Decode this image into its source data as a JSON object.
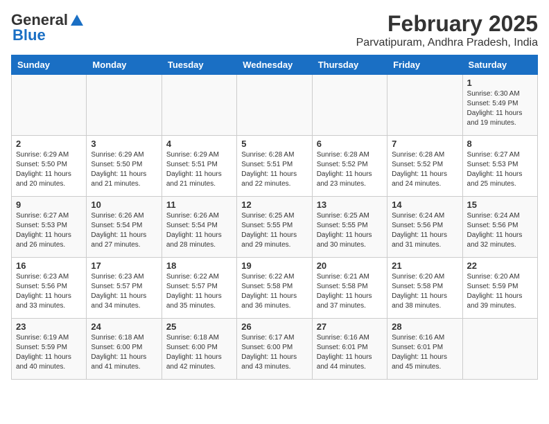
{
  "header": {
    "logo_general": "General",
    "logo_blue": "Blue",
    "title": "February 2025",
    "subtitle": "Parvatipuram, Andhra Pradesh, India"
  },
  "calendar": {
    "days_of_week": [
      "Sunday",
      "Monday",
      "Tuesday",
      "Wednesday",
      "Thursday",
      "Friday",
      "Saturday"
    ],
    "weeks": [
      [
        {
          "day": "",
          "info": ""
        },
        {
          "day": "",
          "info": ""
        },
        {
          "day": "",
          "info": ""
        },
        {
          "day": "",
          "info": ""
        },
        {
          "day": "",
          "info": ""
        },
        {
          "day": "",
          "info": ""
        },
        {
          "day": "1",
          "info": "Sunrise: 6:30 AM\nSunset: 5:49 PM\nDaylight: 11 hours\nand 19 minutes."
        }
      ],
      [
        {
          "day": "2",
          "info": "Sunrise: 6:29 AM\nSunset: 5:50 PM\nDaylight: 11 hours\nand 20 minutes."
        },
        {
          "day": "3",
          "info": "Sunrise: 6:29 AM\nSunset: 5:50 PM\nDaylight: 11 hours\nand 21 minutes."
        },
        {
          "day": "4",
          "info": "Sunrise: 6:29 AM\nSunset: 5:51 PM\nDaylight: 11 hours\nand 21 minutes."
        },
        {
          "day": "5",
          "info": "Sunrise: 6:28 AM\nSunset: 5:51 PM\nDaylight: 11 hours\nand 22 minutes."
        },
        {
          "day": "6",
          "info": "Sunrise: 6:28 AM\nSunset: 5:52 PM\nDaylight: 11 hours\nand 23 minutes."
        },
        {
          "day": "7",
          "info": "Sunrise: 6:28 AM\nSunset: 5:52 PM\nDaylight: 11 hours\nand 24 minutes."
        },
        {
          "day": "8",
          "info": "Sunrise: 6:27 AM\nSunset: 5:53 PM\nDaylight: 11 hours\nand 25 minutes."
        }
      ],
      [
        {
          "day": "9",
          "info": "Sunrise: 6:27 AM\nSunset: 5:53 PM\nDaylight: 11 hours\nand 26 minutes."
        },
        {
          "day": "10",
          "info": "Sunrise: 6:26 AM\nSunset: 5:54 PM\nDaylight: 11 hours\nand 27 minutes."
        },
        {
          "day": "11",
          "info": "Sunrise: 6:26 AM\nSunset: 5:54 PM\nDaylight: 11 hours\nand 28 minutes."
        },
        {
          "day": "12",
          "info": "Sunrise: 6:25 AM\nSunset: 5:55 PM\nDaylight: 11 hours\nand 29 minutes."
        },
        {
          "day": "13",
          "info": "Sunrise: 6:25 AM\nSunset: 5:55 PM\nDaylight: 11 hours\nand 30 minutes."
        },
        {
          "day": "14",
          "info": "Sunrise: 6:24 AM\nSunset: 5:56 PM\nDaylight: 11 hours\nand 31 minutes."
        },
        {
          "day": "15",
          "info": "Sunrise: 6:24 AM\nSunset: 5:56 PM\nDaylight: 11 hours\nand 32 minutes."
        }
      ],
      [
        {
          "day": "16",
          "info": "Sunrise: 6:23 AM\nSunset: 5:56 PM\nDaylight: 11 hours\nand 33 minutes."
        },
        {
          "day": "17",
          "info": "Sunrise: 6:23 AM\nSunset: 5:57 PM\nDaylight: 11 hours\nand 34 minutes."
        },
        {
          "day": "18",
          "info": "Sunrise: 6:22 AM\nSunset: 5:57 PM\nDaylight: 11 hours\nand 35 minutes."
        },
        {
          "day": "19",
          "info": "Sunrise: 6:22 AM\nSunset: 5:58 PM\nDaylight: 11 hours\nand 36 minutes."
        },
        {
          "day": "20",
          "info": "Sunrise: 6:21 AM\nSunset: 5:58 PM\nDaylight: 11 hours\nand 37 minutes."
        },
        {
          "day": "21",
          "info": "Sunrise: 6:20 AM\nSunset: 5:58 PM\nDaylight: 11 hours\nand 38 minutes."
        },
        {
          "day": "22",
          "info": "Sunrise: 6:20 AM\nSunset: 5:59 PM\nDaylight: 11 hours\nand 39 minutes."
        }
      ],
      [
        {
          "day": "23",
          "info": "Sunrise: 6:19 AM\nSunset: 5:59 PM\nDaylight: 11 hours\nand 40 minutes."
        },
        {
          "day": "24",
          "info": "Sunrise: 6:18 AM\nSunset: 6:00 PM\nDaylight: 11 hours\nand 41 minutes."
        },
        {
          "day": "25",
          "info": "Sunrise: 6:18 AM\nSunset: 6:00 PM\nDaylight: 11 hours\nand 42 minutes."
        },
        {
          "day": "26",
          "info": "Sunrise: 6:17 AM\nSunset: 6:00 PM\nDaylight: 11 hours\nand 43 minutes."
        },
        {
          "day": "27",
          "info": "Sunrise: 6:16 AM\nSunset: 6:01 PM\nDaylight: 11 hours\nand 44 minutes."
        },
        {
          "day": "28",
          "info": "Sunrise: 6:16 AM\nSunset: 6:01 PM\nDaylight: 11 hours\nand 45 minutes."
        },
        {
          "day": "",
          "info": ""
        }
      ]
    ]
  }
}
